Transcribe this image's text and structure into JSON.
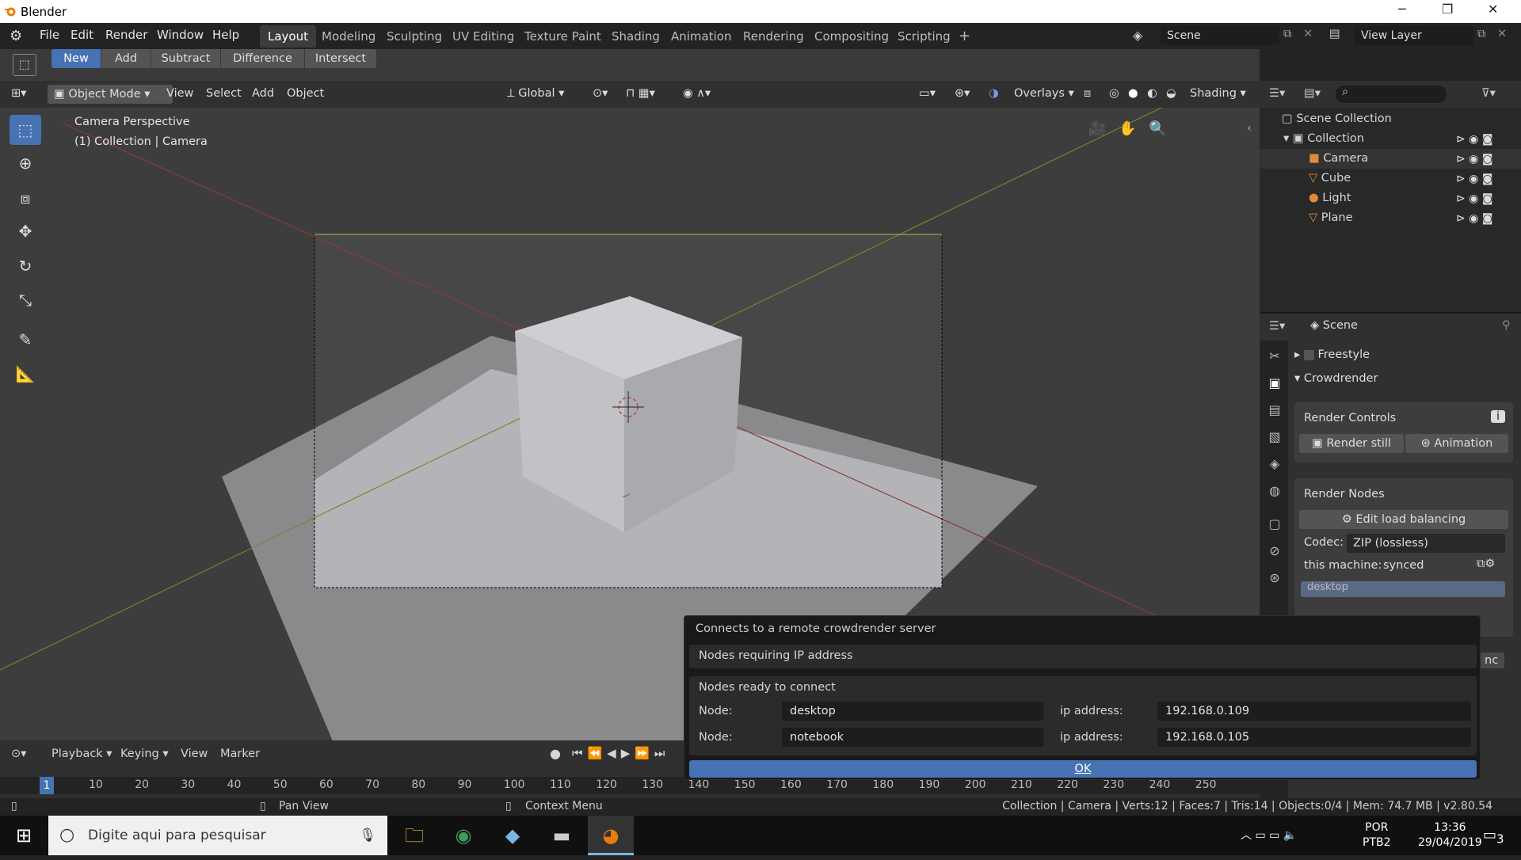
{
  "window": {
    "title": "Blender",
    "minimize": "─",
    "restore": "❐",
    "close": "✕"
  },
  "menu": [
    "File",
    "Edit",
    "Render",
    "Window",
    "Help"
  ],
  "workspaces": [
    "Layout",
    "Modeling",
    "Sculpting",
    "UV Editing",
    "Texture Paint",
    "Shading",
    "Animation",
    "Rendering",
    "Compositing",
    "Scripting",
    "+"
  ],
  "scene": {
    "label": "Scene",
    "view_layer": "View Layer"
  },
  "toolrow": {
    "new": "New",
    "add": "Add",
    "subtract": "Subtract",
    "difference": "Difference",
    "intersect": "Intersect"
  },
  "header": {
    "mode": "Object Mode",
    "view": "View",
    "select": "Select",
    "add": "Add",
    "object": "Object",
    "orientation": "Global",
    "overlays": "Overlays",
    "shading": "Shading"
  },
  "viewport": {
    "line1": "Camera Perspective",
    "line2": "(1) Collection | Camera"
  },
  "outliner": {
    "root": "Scene Collection",
    "collection": "Collection",
    "items": [
      "Camera",
      "Cube",
      "Light",
      "Plane"
    ]
  },
  "properties": {
    "scene": "Scene",
    "freestyle": "Freestyle",
    "crowdrender": "Crowdrender",
    "render_controls": "Render Controls",
    "render_still": "Render still",
    "animation": "Animation",
    "render_nodes": "Render Nodes",
    "edit_lb": "Edit load balancing",
    "codec_label": "Codec:",
    "codec_value": "ZIP (lossless)",
    "this_machine": "this machine:",
    "synced": "synced",
    "node_row": "desktop",
    "sync_btn": "nc"
  },
  "popup": {
    "title": "Connects to a remote crowdrender server",
    "requiring": "Nodes requiring IP address",
    "ready": "Nodes ready to connect",
    "node_label": "Node:",
    "ip_label": "ip address:",
    "nodes": [
      {
        "name": "desktop",
        "ip": "192.168.0.109"
      },
      {
        "name": "notebook",
        "ip": "192.168.0.105"
      }
    ],
    "ok": "OK"
  },
  "timeline": {
    "playback": "Playback",
    "keying": "Keying",
    "view": "View",
    "marker": "Marker",
    "current_frame": "1",
    "ticks": [
      "10",
      "20",
      "30",
      "40",
      "50",
      "60",
      "70",
      "80",
      "90",
      "100",
      "110",
      "120",
      "130",
      "140",
      "150",
      "160",
      "170",
      "180",
      "190",
      "200",
      "210",
      "220",
      "230",
      "240",
      "250"
    ]
  },
  "status": {
    "pan": "Pan View",
    "context": "Context Menu",
    "info": "Collection | Camera | Verts:12 | Faces:7 | Tris:14 | Objects:0/4 | Mem: 74.7 MB | v2.80.54"
  },
  "taskbar": {
    "search": "Digite aqui para pesquisar",
    "lang1": "POR",
    "lang2": "PTB2",
    "time": "13:36",
    "date": "29/04/2019",
    "notif": "3"
  }
}
